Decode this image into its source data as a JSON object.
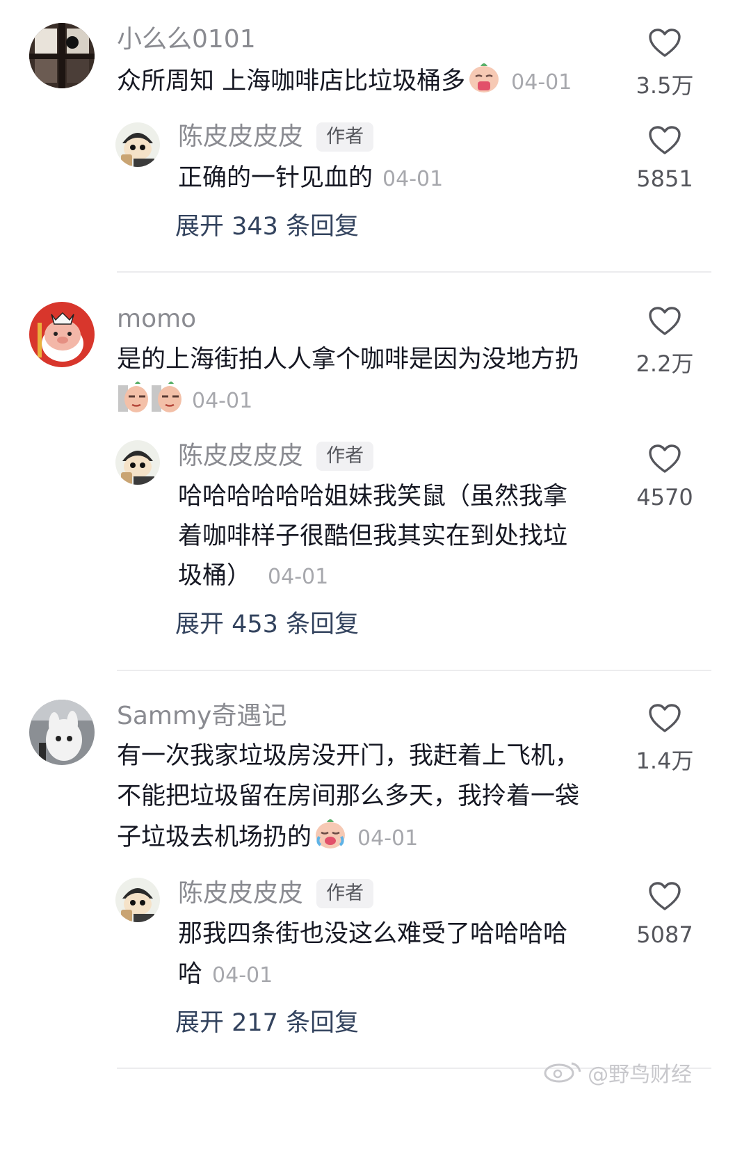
{
  "comments": [
    {
      "username": "小么么0101",
      "text": "众所周知 上海咖啡店比垃圾桶多",
      "date": "04-01",
      "likes": "3.5万",
      "reply": {
        "username": "陈皮皮皮皮",
        "badge": "作者",
        "text": "正确的一针见血的",
        "date": "04-01",
        "likes": "5851"
      },
      "expand_label": "展开 343 条回复"
    },
    {
      "username": "momo",
      "text_line1": "是的上海街拍人人拿个咖啡是因为没地方扔",
      "date": "04-01",
      "likes": "2.2万",
      "reply": {
        "username": "陈皮皮皮皮",
        "badge": "作者",
        "text_line1": "哈哈哈哈哈哈姐妹我笑鼠（虽然我拿",
        "text_line2": "着咖啡样子很酷但我其实在到处找垃",
        "text_line3": "圾桶）",
        "date": "04-01",
        "likes": "4570"
      },
      "expand_label": "展开 453 条回复"
    },
    {
      "username": "Sammy奇遇记",
      "text_line1": "有一次我家垃圾房没开门，我赶着上飞机，",
      "text_line2": "不能把垃圾留在房间那么多天，我拎着一袋",
      "text_line3": "子垃圾去机场扔的",
      "date": "04-01",
      "likes": "1.4万",
      "reply": {
        "username": "陈皮皮皮皮",
        "badge": "作者",
        "text_line1": "那我四条街也没这么难受了哈哈哈哈",
        "text_line2": "哈",
        "date": "04-01",
        "likes": "5087"
      },
      "expand_label": "展开 217 条回复"
    }
  ],
  "watermark": "@野鸟财经",
  "icons": {
    "like": "heart-outline-icon",
    "watermark": "weibo-logo-icon"
  },
  "colors": {
    "text": "#161823",
    "username": "#8a8b91",
    "date": "#a7a8ad",
    "expand": "#33435e",
    "badge_bg": "#f1f1f3"
  }
}
